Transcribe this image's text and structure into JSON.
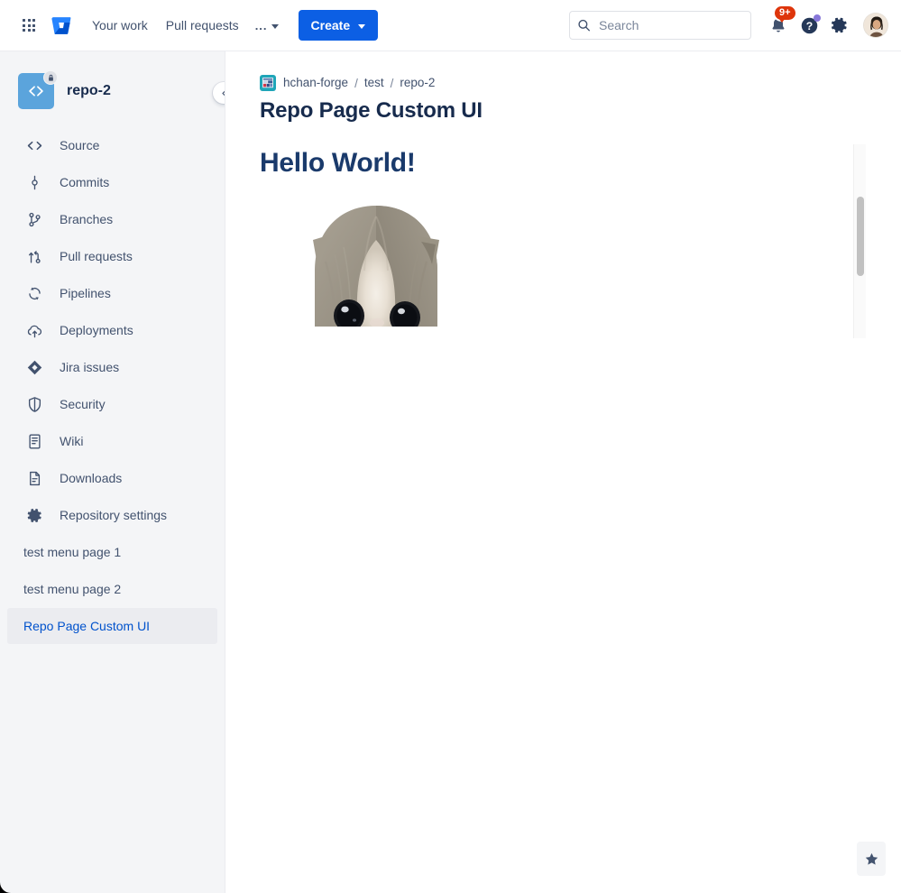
{
  "topnav": {
    "app_switcher_label": "app-switcher",
    "product_logo": "bitbucket-logo",
    "links": [
      {
        "label": "Your work"
      },
      {
        "label": "Pull requests"
      }
    ],
    "more_label": "...",
    "create_label": "Create",
    "search": {
      "placeholder": "Search",
      "value": ""
    },
    "notifications": {
      "badge": "9+"
    },
    "help_label": "help-icon",
    "settings_label": "settings-icon",
    "avatar_label": "user-avatar"
  },
  "sidebar": {
    "repo_name": "repo-2",
    "repo_access": "private",
    "collapse_label": "collapse-sidebar",
    "items": [
      {
        "label": "Source",
        "icon": "source-icon",
        "selected": false
      },
      {
        "label": "Commits",
        "icon": "commits-icon",
        "selected": false
      },
      {
        "label": "Branches",
        "icon": "branches-icon",
        "selected": false
      },
      {
        "label": "Pull requests",
        "icon": "pull-requests-icon",
        "selected": false
      },
      {
        "label": "Pipelines",
        "icon": "pipelines-icon",
        "selected": false
      },
      {
        "label": "Deployments",
        "icon": "deployments-icon",
        "selected": false
      },
      {
        "label": "Jira issues",
        "icon": "jira-icon",
        "selected": false
      },
      {
        "label": "Security",
        "icon": "security-icon",
        "selected": false
      },
      {
        "label": "Wiki",
        "icon": "wiki-icon",
        "selected": false
      },
      {
        "label": "Downloads",
        "icon": "downloads-icon",
        "selected": false
      },
      {
        "label": "Repository settings",
        "icon": "settings-icon",
        "selected": false
      }
    ],
    "custom_items": [
      {
        "label": "test menu page 1",
        "selected": false
      },
      {
        "label": "test menu page 2",
        "selected": false
      },
      {
        "label": "Repo Page Custom UI",
        "selected": true
      }
    ]
  },
  "main": {
    "breadcrumb": [
      {
        "label": "hchan-forge"
      },
      {
        "label": "test"
      },
      {
        "label": "repo-2"
      }
    ],
    "breadcrumb_separator": "/",
    "page_title": "Repo Page Custom UI",
    "custom_ui": {
      "heading": "Hello World!",
      "image_alt": "kitten-photo"
    }
  },
  "footer": {
    "star_button_label": "give-feedback-star"
  },
  "colors": {
    "accent_blue": "#0C5FE4",
    "link_blue": "#0052CC",
    "sidebar_bg": "#F4F5F7",
    "text_primary": "#172B4D",
    "text_secondary": "#42526E",
    "badge_red": "#DE350B",
    "help_dot_purple": "#8777D9",
    "repo_avatar_blue": "#5BA4DC",
    "heading_navy": "#1A3A6B"
  }
}
